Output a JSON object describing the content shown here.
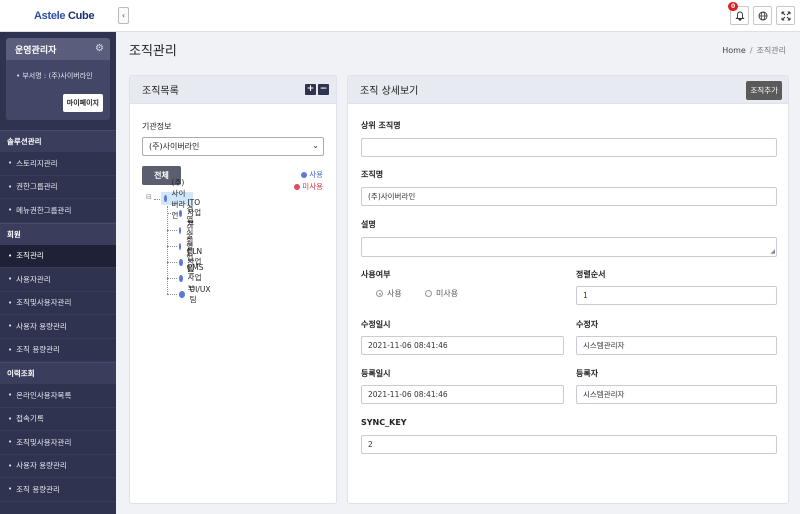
{
  "app": {
    "logo_part1": "Astele ",
    "logo_part2": "Cube"
  },
  "sidebar": {
    "admin_title": "운영관리자",
    "dept_label": "부서명 : (주)사이버라인",
    "mypage_label": "마이페이지",
    "sections": [
      {
        "title": "솔루션관리",
        "items": [
          "스토리지관리",
          "권한그룹관리",
          "메뉴권한그룹관리"
        ]
      },
      {
        "title": "회원",
        "items": [
          "조직관리",
          "사용자관리",
          "조직및사용자관리",
          "사용자 용량관리",
          "조직 용량관리"
        ]
      },
      {
        "title": "이력조회",
        "items": [
          "온라인사용자목록",
          "접속기록",
          "조직및사용자관리",
          "사용자 용량관리",
          "조직 용량관리"
        ]
      }
    ],
    "active_item": "조직관리"
  },
  "topbar": {
    "notification_count": "0",
    "icons": [
      "bell-icon",
      "globe-icon",
      "fullscreen-icon"
    ]
  },
  "page": {
    "title": "조직관리",
    "breadcrumb": {
      "home": "Home",
      "separator": "/",
      "current": "조직관리"
    }
  },
  "left_panel": {
    "title": "조직목록",
    "org_info_label": "기관정보",
    "org_select_value": "(주)사이버라인",
    "all_button": "전체",
    "legend_use": "사용",
    "legend_unuse": "미사용",
    "tree_root": "(주)사이버라인",
    "tree_children": [
      "ITO사업부",
      "경영지원팀",
      "기술영업팀",
      "ELN사업부",
      "PMS사업부",
      "UI/UX팀"
    ]
  },
  "right_panel": {
    "title": "조직 상세보기",
    "add_button": "조직추가",
    "parent_org_label": "상위 조직명",
    "parent_org_value": "",
    "org_name_label": "조직명",
    "org_name_value": "(주)사이버라인",
    "description_label": "설명",
    "description_value": "",
    "use_label": "사용여부",
    "use_option": "사용",
    "unuse_option": "미사용",
    "sort_label": "정렬순서",
    "sort_value": "1",
    "modified_at_label": "수정일시",
    "modified_at_value": "2021-11-06 08:41:46",
    "modifier_label": "수정자",
    "modifier_value": "시스템관리자",
    "created_at_label": "등록일시",
    "created_at_value": "2021-11-06 08:41:46",
    "creator_label": "등록자",
    "creator_value": "시스템관리자",
    "sync_key_label": "SYNC_KEY",
    "sync_key_value": "2"
  }
}
